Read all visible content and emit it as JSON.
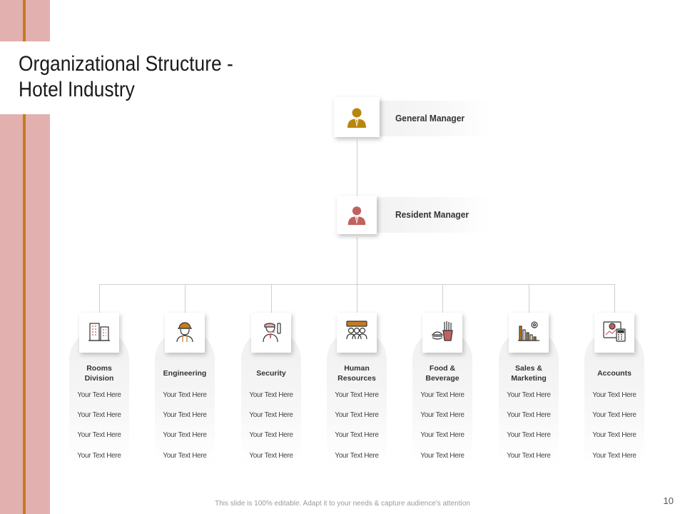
{
  "slide": {
    "title_line1": "Organizational Structure -",
    "title_line2": "Hotel Industry",
    "footer": "This slide is 100% editable. Adapt it to your needs & capture audience's attention",
    "page_number": "10"
  },
  "colors": {
    "band": "#e3b0b0",
    "accent_line": "#c67c1d",
    "gm_icon": "#b8860b",
    "rm_icon": "#c0625f"
  },
  "managers": [
    {
      "label": "General Manager",
      "icon": "user-icon"
    },
    {
      "label": "Resident Manager",
      "icon": "user-icon"
    }
  ],
  "departments": [
    {
      "name": "Rooms\nDivision",
      "icon": "building-icon",
      "items": [
        "Your Text Here",
        "Your Text Here",
        "Your Text Here",
        "Your Text Here"
      ]
    },
    {
      "name": "Engineering",
      "icon": "engineer-icon",
      "items": [
        "Your Text Here",
        "Your Text Here",
        "Your Text Here",
        "Your Text Here"
      ]
    },
    {
      "name": "Security",
      "icon": "security-guard-icon",
      "items": [
        "Your Text Here",
        "Your Text Here",
        "Your Text Here",
        "Your Text Here"
      ]
    },
    {
      "name": "Human\nResources",
      "icon": "team-icon",
      "items": [
        "Your Text Here",
        "Your Text Here",
        "Your Text Here",
        "Your Text Here"
      ]
    },
    {
      "name": "Food &\nBeverage",
      "icon": "fast-food-icon",
      "items": [
        "Your Text Here",
        "Your Text Here",
        "Your Text Here",
        "Your Text Here"
      ]
    },
    {
      "name": "Sales &\nMarketing",
      "icon": "chart-gear-icon",
      "items": [
        "Your Text Here",
        "Your Text Here",
        "Your Text Here",
        "Your Text Here"
      ]
    },
    {
      "name": "Accounts",
      "icon": "calculator-icon",
      "items": [
        "Your Text Here",
        "Your Text Here",
        "Your Text Here",
        "Your Text Here"
      ]
    }
  ]
}
